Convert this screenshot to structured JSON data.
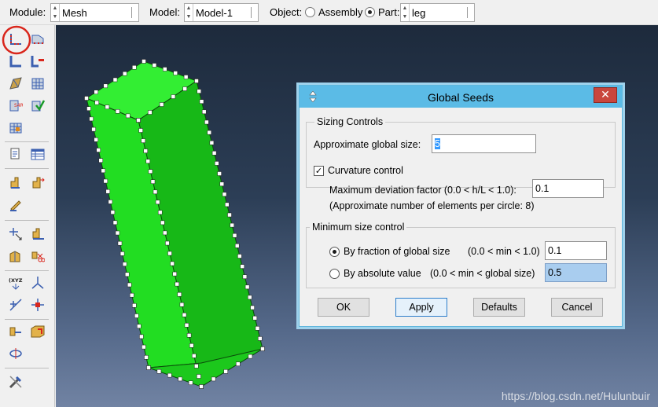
{
  "topbar": {
    "module_label": "Module:",
    "module_value": "Mesh",
    "model_label": "Model:",
    "model_value": "Model-1",
    "object_label": "Object:",
    "assembly_label": "Assembly",
    "part_label": "Part:",
    "part_value": "leg",
    "object_selected": "Part"
  },
  "toolbox": {
    "tools": [
      "seed-part-icon",
      "seed-edges-icon",
      "mesh-controls-icon",
      "element-type-icon",
      "partition-icon",
      "mesh-part-icon",
      "virtual-topology-icon",
      "verify-mesh-icon",
      "assign-stack-icon",
      "query-icon",
      "table-icon",
      "edit-mesh-icon",
      "mesh-region-icon",
      "datum-icon",
      "select-icon",
      "delete-icon",
      "partition-face-icon",
      "datum-csys-icon",
      "datum-point-icon",
      "datum-axis-icon",
      "datum-plane-icon",
      "tools-icon"
    ],
    "active_tool": "seed-part-icon",
    "highlight_color": "#d9261c"
  },
  "viewport": {
    "part_color": "#19e619",
    "background_top": "#1d2a3c",
    "background_bottom": "#7183a3",
    "watermark": "https://blog.csdn.net/Hulunbuir"
  },
  "dialog": {
    "title": "Global Seeds",
    "close_symbol": "✕",
    "sizing_group": "Sizing Controls",
    "approx_size_label": "Approximate global size:",
    "approx_size_value": "5",
    "curvature_label": "Curvature control",
    "curvature_checked": true,
    "max_dev_label": "Maximum deviation factor (0.0 < h/L < 1.0):",
    "max_dev_value": "0.1",
    "approx_elements_note": "(Approximate number of elements per circle: 8)",
    "min_size_group": "Minimum size control",
    "by_fraction_label": "By fraction of global size",
    "by_fraction_range": "(0.0 < min < 1.0)",
    "by_fraction_value": "0.1",
    "by_absolute_label": "By absolute value",
    "by_absolute_range": "(0.0 < min < global size)",
    "by_absolute_value": "0.5",
    "min_size_mode": "fraction",
    "buttons": {
      "ok": "OK",
      "apply": "Apply",
      "defaults": "Defaults",
      "cancel": "Cancel"
    }
  }
}
